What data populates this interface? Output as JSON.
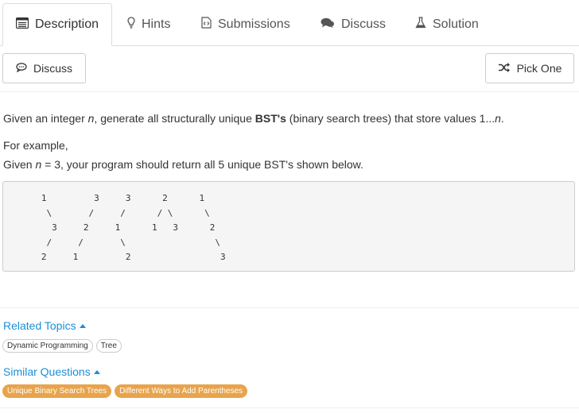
{
  "tabs": [
    {
      "label": "Description",
      "icon": "document-icon",
      "active": true
    },
    {
      "label": "Hints",
      "icon": "lightbulb-icon",
      "active": false
    },
    {
      "label": "Submissions",
      "icon": "code-file-icon",
      "active": false
    },
    {
      "label": "Discuss",
      "icon": "comments-icon",
      "active": false
    },
    {
      "label": "Solution",
      "icon": "flask-icon",
      "active": false
    }
  ],
  "toolbar": {
    "discuss_label": "Discuss",
    "pick_one_label": "Pick One"
  },
  "problem": {
    "desc_pre": "Given an integer ",
    "desc_var": "n",
    "desc_mid": ", generate all structurally unique ",
    "desc_bold": "BST's",
    "desc_post": " (binary search trees) that store values 1...",
    "desc_end_var": "n",
    "desc_end": ".",
    "example_label": "For example,",
    "given_pre": "Given ",
    "given_var": "n",
    "given_post": " = 3, your program should return all 5 unique BST's shown below.",
    "code": "   1         3     3      2      1\n    \\       /     /      / \\      \\\n     3     2     1      1   3      2\n    /     /       \\                 \\\n   2     1         2                 3"
  },
  "related_topics": {
    "title": "Related Topics",
    "tags": [
      "Dynamic Programming",
      "Tree"
    ]
  },
  "similar_questions": {
    "title": "Similar Questions",
    "tags": [
      "Unique Binary Search Trees",
      "Different Ways to Add Parentheses"
    ]
  },
  "colors": {
    "link": "#1a8fd8",
    "similar_tag": "#e8a44c"
  }
}
